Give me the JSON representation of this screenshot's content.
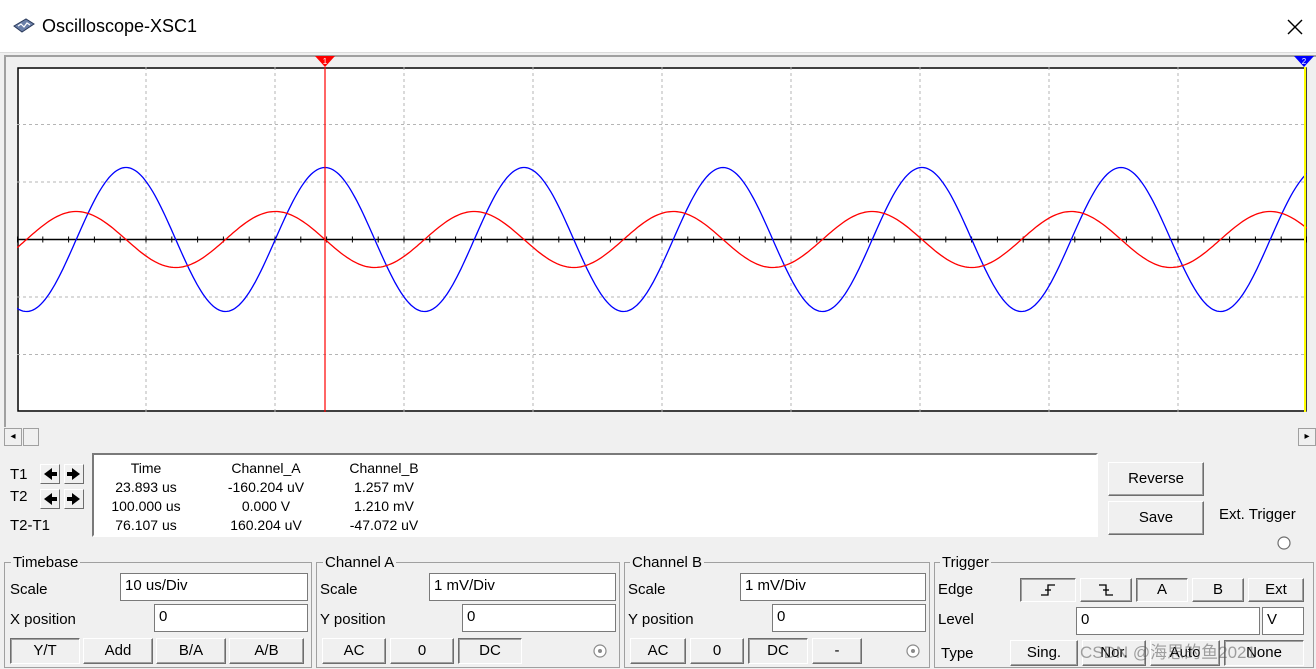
{
  "window": {
    "title": "Oscilloscope-XSC1",
    "icon": "oscilloscope-icon",
    "close_icon": "close-icon"
  },
  "cursors": {
    "t1_color": "#ff0000",
    "t2_color": "#0000ff",
    "t1_marker": "1",
    "t2_marker": "2"
  },
  "traces": {
    "channel_a_color": "#ff0000",
    "channel_b_color": "#0000ff"
  },
  "measurements": {
    "labels": {
      "t1": "T1",
      "t2": "T2",
      "t2_t1": "T2-T1"
    },
    "headers": {
      "time": "Time",
      "channel_a": "Channel_A",
      "channel_b": "Channel_B"
    },
    "rows": [
      {
        "time": "23.893 us",
        "channel_a": "-160.204 uV",
        "channel_b": "1.257 mV"
      },
      {
        "time": "100.000 us",
        "channel_a": "0.000 V",
        "channel_b": "1.210 mV"
      },
      {
        "time": "76.107 us",
        "channel_a": "160.204 uV",
        "channel_b": "-47.072 uV"
      }
    ]
  },
  "actions": {
    "reverse": "Reverse",
    "save": "Save",
    "ext_trigger": "Ext. Trigger"
  },
  "timebase": {
    "title": "Timebase",
    "scale_label": "Scale",
    "scale_value": "10 us/Div",
    "xpos_label": "X position",
    "xpos_value": "0",
    "modes": [
      "Y/T",
      "Add",
      "B/A",
      "A/B"
    ]
  },
  "channel_a": {
    "title": "Channel A",
    "scale_label": "Scale",
    "scale_value": "1 mV/Div",
    "ypos_label": "Y position",
    "ypos_value": "0",
    "coupling": [
      "AC",
      "0",
      "DC"
    ]
  },
  "channel_b": {
    "title": "Channel B",
    "scale_label": "Scale",
    "scale_value": "1 mV/Div",
    "ypos_label": "Y position",
    "ypos_value": "0",
    "coupling": [
      "AC",
      "0",
      "DC",
      "-"
    ]
  },
  "trigger": {
    "title": "Trigger",
    "edge_label": "Edge",
    "sources": [
      "A",
      "B",
      "Ext"
    ],
    "level_label": "Level",
    "level_value": "0",
    "level_unit": "V",
    "type_label": "Type",
    "types": [
      "Sing.",
      "Nor.",
      "Auto",
      "None"
    ]
  },
  "watermark": "CSDN @海思的鱼2021"
}
